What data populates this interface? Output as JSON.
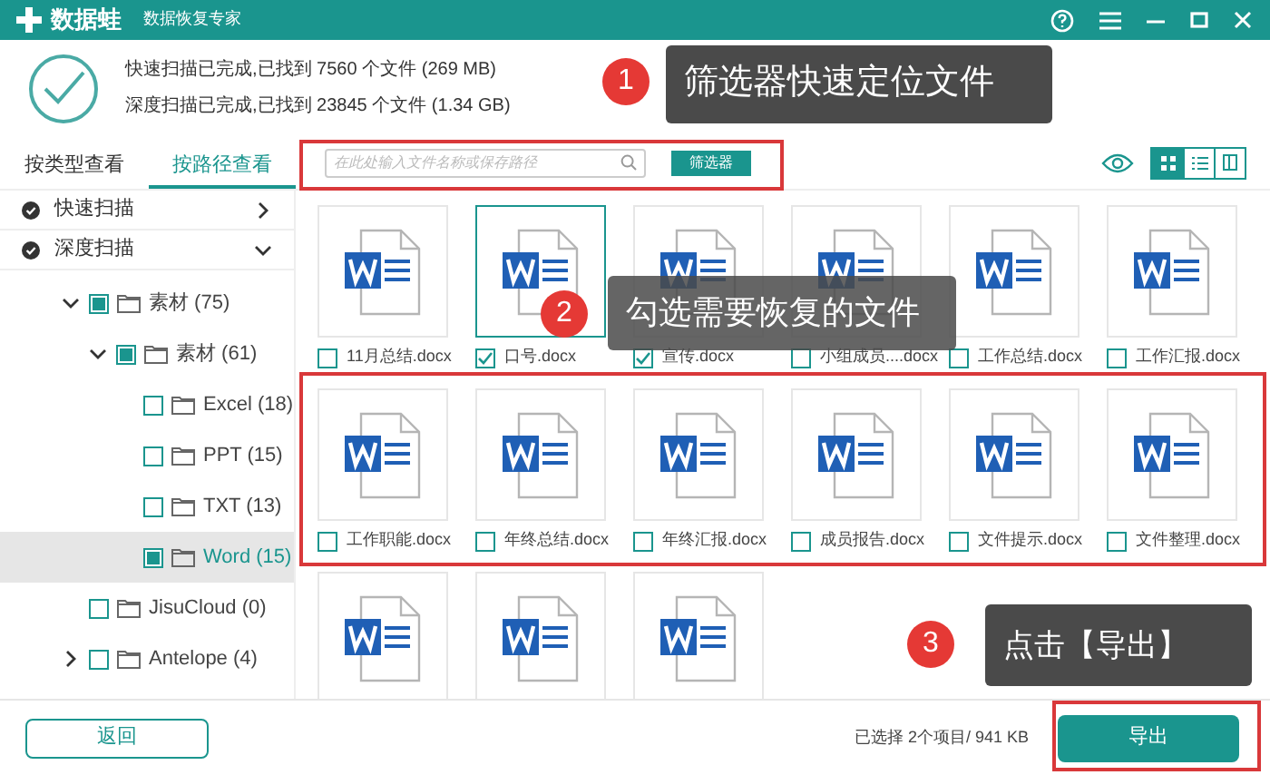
{
  "app": {
    "name": "数据蛙",
    "subtitle": "数据恢复专家"
  },
  "scan_results": [
    "快速扫描已完成,已找到 7560 个文件 (269 MB)",
    "深度扫描已完成,已找到 23845 个文件 (1.34 GB)"
  ],
  "tabs": [
    {
      "label": "按类型查看",
      "selected": false
    },
    {
      "label": "按路径查看",
      "selected": true
    }
  ],
  "search": {
    "placeholder": "在此处输入文件名称或保存路径"
  },
  "filter_button": "筛选器",
  "view_modes": [
    {
      "kind": "grid",
      "selected": true
    },
    {
      "kind": "list",
      "selected": false
    },
    {
      "kind": "columns",
      "selected": false
    }
  ],
  "scans": [
    {
      "label": "快速扫描",
      "expanded": false
    },
    {
      "label": "深度扫描",
      "expanded": true
    }
  ],
  "tree": [
    {
      "label": "素材 (75)",
      "expanded": true,
      "mixed": true,
      "selected": false,
      "children": [
        {
          "label": "素材 (61)",
          "expanded": true,
          "mixed": true,
          "selected": false,
          "children": [
            {
              "label": "Excel (18)",
              "mixed": false,
              "selected": false
            },
            {
              "label": "PPT (15)",
              "mixed": false,
              "selected": false
            },
            {
              "label": "TXT (13)",
              "mixed": false,
              "selected": false
            },
            {
              "label": "Word (15)",
              "mixed": true,
              "selected": true
            }
          ]
        }
      ]
    },
    {
      "label": "JisuCloud (0)",
      "mixed": false,
      "selected": false
    },
    {
      "label": "Antelope (4)",
      "expanded": false,
      "mixed": false,
      "selected": false
    }
  ],
  "files": [
    {
      "name": "11月总结.docx",
      "checked": false,
      "selected": false
    },
    {
      "name": "口号.docx",
      "checked": true,
      "selected": true
    },
    {
      "name": "宣传.docx",
      "checked": true,
      "selected": false
    },
    {
      "name": "小组成员....docx",
      "checked": false,
      "selected": false
    },
    {
      "name": "工作总结.docx",
      "checked": false,
      "selected": false
    },
    {
      "name": "工作汇报.docx",
      "checked": false,
      "selected": false
    },
    {
      "name": "工作职能.docx",
      "checked": false,
      "selected": false
    },
    {
      "name": "年终总结.docx",
      "checked": false,
      "selected": false
    },
    {
      "name": "年终汇报.docx",
      "checked": false,
      "selected": false
    },
    {
      "name": "成员报告.docx",
      "checked": false,
      "selected": false
    },
    {
      "name": "文件提示.docx",
      "checked": false,
      "selected": false
    },
    {
      "name": "文件整理.docx",
      "checked": false,
      "selected": false
    },
    {
      "selected": false
    },
    {
      "selected": false
    },
    {
      "selected": false
    }
  ],
  "footer": {
    "back_button": "返回",
    "selection_summary": "已选择 2个项目/ 941 KB",
    "export_button": "导出"
  },
  "callouts": [
    {
      "number": "1",
      "text": "筛选器快速定位文件"
    },
    {
      "number": "2",
      "text": "勾选需要恢复的文件"
    },
    {
      "number": "3",
      "text": "点击【导出】"
    }
  ]
}
